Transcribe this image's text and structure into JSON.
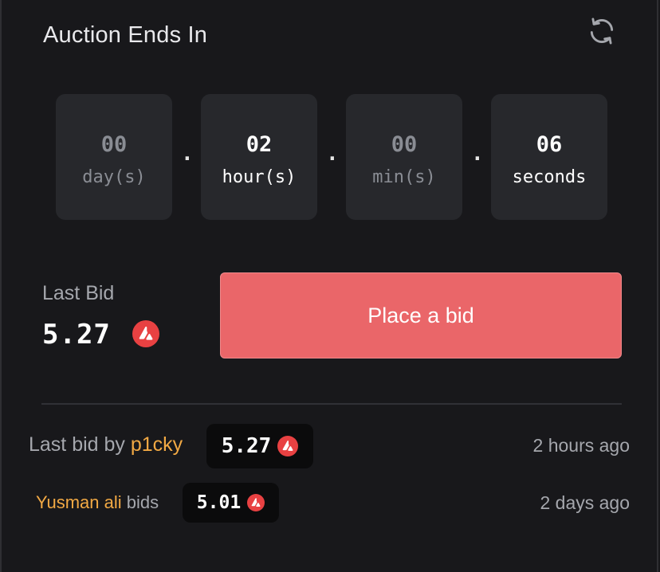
{
  "header": {
    "title": "Auction Ends In",
    "refresh_icon": "refresh-icon"
  },
  "countdown": {
    "days": {
      "value": "00",
      "label": "day(s)"
    },
    "hours": {
      "value": "02",
      "label": "hour(s)"
    },
    "minutes": {
      "value": "00",
      "label": "min(s)"
    },
    "seconds": {
      "value": "06",
      "label": "seconds"
    },
    "separator": "."
  },
  "bid": {
    "last_bid_label": "Last Bid",
    "last_bid_value": "5.27",
    "place_bid_label": "Place a bid",
    "token_icon": "avalanche-icon"
  },
  "history": [
    {
      "prefix": "Last bid by ",
      "user": "p1cky",
      "suffix": "",
      "amount": "5.27",
      "time": "2 hours ago"
    },
    {
      "prefix": "",
      "user": "Yusman ali",
      "suffix": " bids",
      "amount": "5.01",
      "time": "2 days ago"
    }
  ],
  "colors": {
    "background": "#18181b",
    "tile": "#27282c",
    "accent": "#ea6669",
    "username": "#f2a944",
    "pill": "#0b0b0c"
  }
}
